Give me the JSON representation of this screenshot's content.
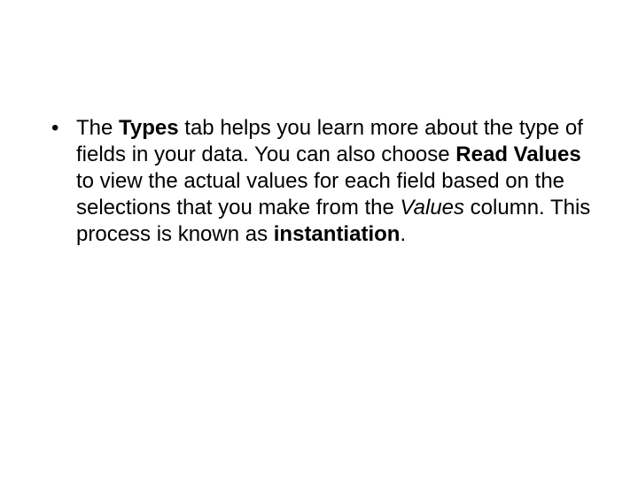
{
  "bullet": {
    "part1": "The ",
    "bold1": "Types",
    "part2": " tab helps you learn more about the type of fields in your data. You can also choose ",
    "bold2": "Read Values",
    "part3": " to view the actual values for each field based on the selections that you make from the ",
    "italic1": "Values",
    "part4": " column. This process is known as ",
    "bold3": "instantiation",
    "part5": "."
  }
}
